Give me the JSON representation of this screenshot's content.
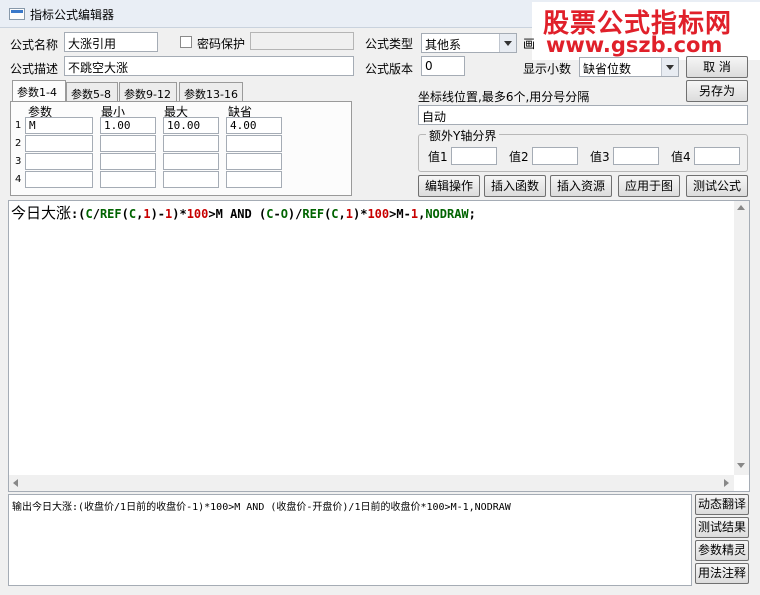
{
  "window": {
    "title": "指标公式编辑器"
  },
  "watermark": {
    "line1": "股票公式指标网",
    "line2": "www.gszb.com"
  },
  "form": {
    "name_label": "公式名称",
    "name_value": "大涨引用",
    "password_label": "密码保护",
    "password_value": "",
    "type_label": "公式类型",
    "type_value": "其他系",
    "draw_label": "画",
    "desc_label": "公式描述",
    "desc_value": "不跳空大涨",
    "version_label": "公式版本",
    "version_value": "0",
    "decimal_label": "显示小数",
    "decimal_value": "缺省位数"
  },
  "buttons": {
    "cancel": "取 消",
    "save_as": "另存为",
    "edit_ops": "编辑操作",
    "insert_func": "插入函数",
    "insert_res": "插入资源",
    "apply": "应用于图",
    "test": "测试公式"
  },
  "tabs": [
    "参数1-4",
    "参数5-8",
    "参数9-12",
    "参数13-16"
  ],
  "params": {
    "headers": [
      "参数",
      "最小",
      "最大",
      "缺省"
    ],
    "rows": [
      {
        "num": "1",
        "name": "M",
        "min": "1.00",
        "max": "10.00",
        "default": "4.00"
      },
      {
        "num": "2",
        "name": "",
        "min": "",
        "max": "",
        "default": ""
      },
      {
        "num": "3",
        "name": "",
        "min": "",
        "max": "",
        "default": ""
      },
      {
        "num": "4",
        "name": "",
        "min": "",
        "max": "",
        "default": ""
      }
    ]
  },
  "coord": {
    "label": "坐标线位置,最多6个,用分号分隔",
    "value": "自动"
  },
  "yaxis": {
    "title": "额外Y轴分界",
    "labels": [
      "值1",
      "值2",
      "值3",
      "值4"
    ],
    "values": [
      "",
      "",
      "",
      ""
    ]
  },
  "code": {
    "t1": "今日大涨",
    "t2": ":(",
    "t3": "C",
    "t4": "/",
    "t5": "REF",
    "t6": "(",
    "t7": "C",
    "t8": ",",
    "t9": "1",
    "t10": ")-",
    "t11": "1",
    "t12": ")*",
    "t13": "100",
    "t14": ">",
    "t15": "M",
    "t16": " AND (",
    "t17": "C",
    "t18": "-",
    "t19": "O",
    "t20": ")/",
    "t21": "REF",
    "t22": "(",
    "t23": "C",
    "t24": ",",
    "t25": "1",
    "t26": ")*",
    "t27": "100",
    "t28": ">",
    "t29": "M",
    "t30": "-",
    "t31": "1",
    "t32": ",",
    "t33": "NODRAW",
    "t34": ";"
  },
  "output": {
    "text": "输出今日大涨:(收盘价/1日前的收盘价-1)*100>M AND (收盘价-开盘价)/1日前的收盘价*100>M-1,NODRAW"
  },
  "side_buttons": [
    "动态翻译",
    "测试结果",
    "参数精灵",
    "用法注释"
  ],
  "colors": {
    "keyword": "#006400",
    "number": "#c80000",
    "operator": "#000000",
    "watermark": "#e0202a"
  }
}
